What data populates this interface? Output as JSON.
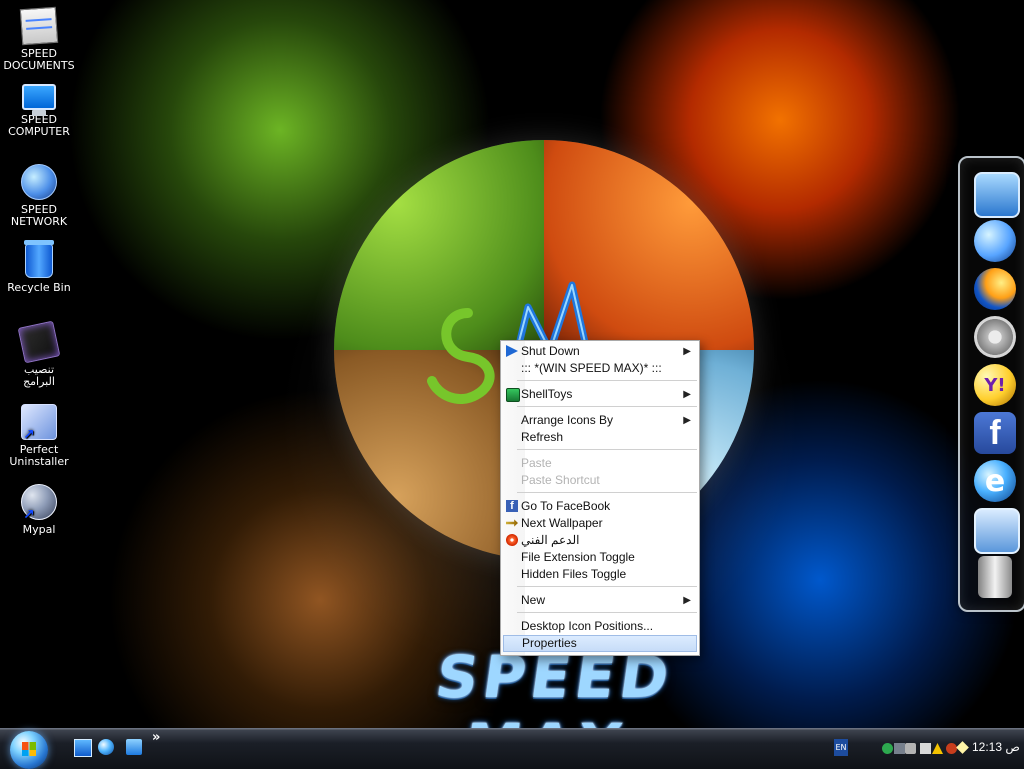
{
  "desktop": {
    "brand": "SPEED MAX",
    "icons": [
      {
        "label": "SPEED\nDOCUMENTS",
        "icon": "documents-icon"
      },
      {
        "label": "SPEED\nCOMPUTER",
        "icon": "computer-icon"
      },
      {
        "label": "SPEED\nNETWORK",
        "icon": "network-icon"
      },
      {
        "label": "Recycle Bin",
        "icon": "recycle-bin-icon"
      },
      {
        "label": "تنصيب\nالبرامج",
        "icon": "programs-icon"
      },
      {
        "label": "Perfect\nUninstaller",
        "icon": "uninstaller-icon"
      },
      {
        "label": "Mypal",
        "icon": "mypal-icon"
      }
    ]
  },
  "dock": {
    "items": [
      {
        "icon": "computer-icon"
      },
      {
        "icon": "earth-icon"
      },
      {
        "icon": "firefox-icon"
      },
      {
        "icon": "settings-icon"
      },
      {
        "icon": "yahoo-messenger-icon",
        "text": "Y!"
      },
      {
        "icon": "facebook-icon",
        "text": "f"
      },
      {
        "icon": "internet-explorer-icon",
        "text": "e"
      },
      {
        "icon": "finder-icon"
      },
      {
        "icon": "trash-icon"
      }
    ]
  },
  "context_menu": {
    "items": [
      {
        "label": "Shut Down",
        "has_arrow": true,
        "icon": "shutdown-icon"
      },
      {
        "label": "::: *(WIN SPEED MAX)* :::",
        "has_arrow": false
      },
      {
        "label": "ShellToys",
        "has_arrow": true,
        "icon": "shelltoys-icon"
      },
      {
        "label": "Arrange Icons By",
        "has_arrow": true
      },
      {
        "label": "Refresh",
        "has_arrow": false
      },
      {
        "label": "Paste",
        "has_arrow": false,
        "disabled": true
      },
      {
        "label": "Paste Shortcut",
        "has_arrow": false,
        "disabled": true
      },
      {
        "label": "Go To FaceBook",
        "has_arrow": false,
        "icon": "facebook-icon"
      },
      {
        "label": "Next Wallpaper",
        "has_arrow": false,
        "icon": "next-wallpaper-icon"
      },
      {
        "label": "الدعم الفني",
        "has_arrow": false,
        "icon": "support-icon"
      },
      {
        "label": "File Extension Toggle",
        "has_arrow": false
      },
      {
        "label": "Hidden Files Toggle",
        "has_arrow": false
      },
      {
        "label": "New",
        "has_arrow": true
      },
      {
        "label": "Desktop Icon Positions...",
        "has_arrow": false
      },
      {
        "label": "Properties",
        "has_arrow": false,
        "selected": true
      }
    ]
  },
  "taskbar": {
    "more_label": "»",
    "lang": "EN",
    "clock": "12:13 ص"
  }
}
